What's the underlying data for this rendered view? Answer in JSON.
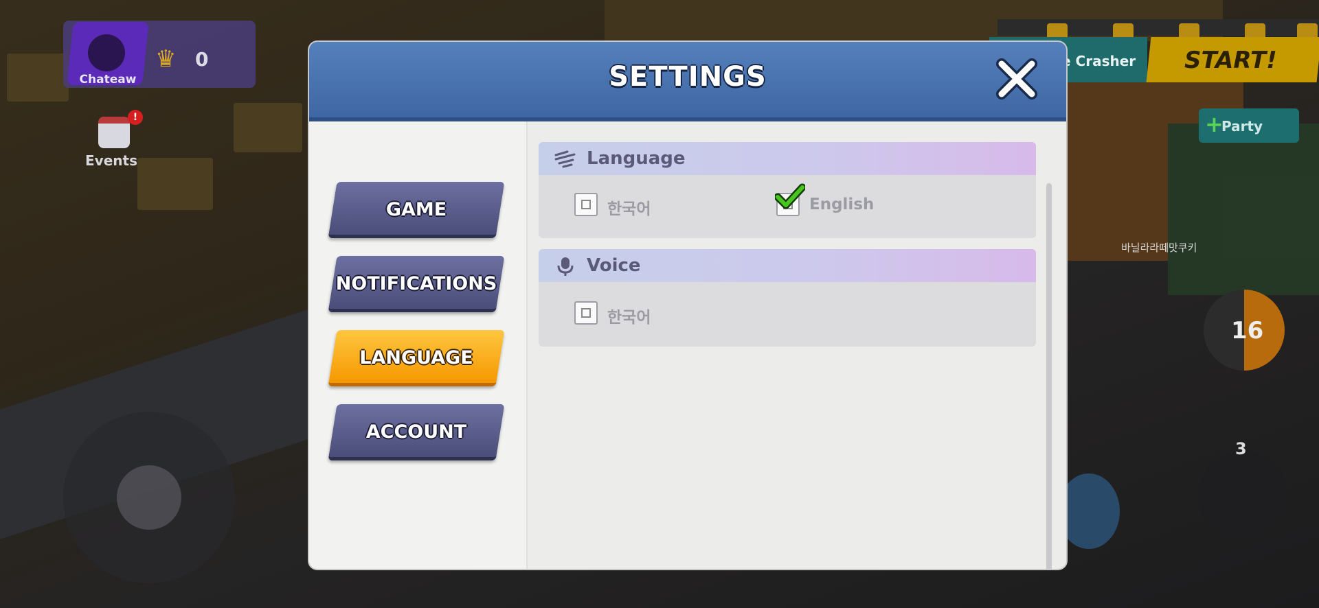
{
  "hud": {
    "player_name": "Chateaw",
    "crown_count": "0",
    "events_label": "Events",
    "events_badge": "!",
    "mode_label": "e Crasher",
    "start_label": "START!",
    "party_label": "Party",
    "nametag": "바닐라라떼맛쿠키",
    "timer_value": "16",
    "ammo_count": "3"
  },
  "dialog": {
    "title": "SETTINGS",
    "close_icon": "close-icon",
    "tabs": [
      {
        "label": "GAME",
        "active": false
      },
      {
        "label": "NOTIFICATIONS",
        "active": false
      },
      {
        "label": "LANGUAGE",
        "active": true
      },
      {
        "label": "ACCOUNT",
        "active": false
      }
    ],
    "sections": {
      "language": {
        "title": "Language",
        "icon": "language-icon",
        "options": [
          {
            "label": "한국어",
            "checked": false
          },
          {
            "label": "English",
            "checked": true
          }
        ]
      },
      "voice": {
        "title": "Voice",
        "icon": "microphone-icon",
        "options": [
          {
            "label": "한국어",
            "checked": false
          }
        ]
      }
    }
  },
  "colors": {
    "header_blue": "#4a74b0",
    "active_tab": "#f7a800",
    "inactive_tab": "#5d5f8e",
    "check_green": "#43c21e"
  }
}
